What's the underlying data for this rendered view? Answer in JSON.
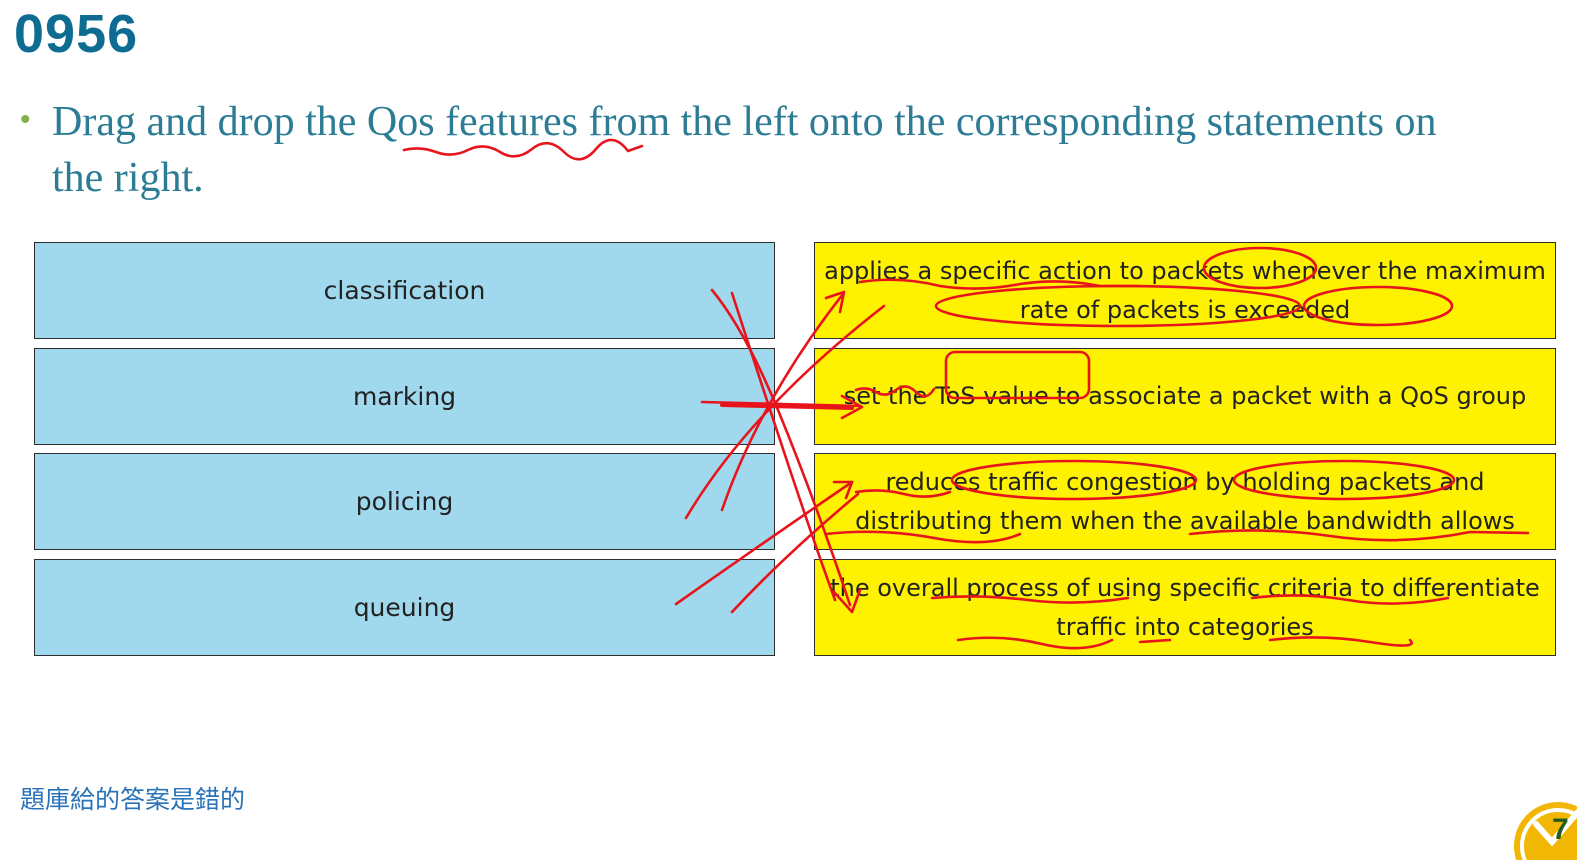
{
  "slide": {
    "number": "0956",
    "bullet": "•",
    "instruction": "Drag and drop the Qos features from the left onto the corresponding statements on the right."
  },
  "features": [
    {
      "label": "classification"
    },
    {
      "label": "marking"
    },
    {
      "label": "policing"
    },
    {
      "label": "queuing"
    }
  ],
  "statements": [
    {
      "text": "applies a specific action to packets whenever the maximum rate of packets is exceeded"
    },
    {
      "text": "set the ToS value to associate a packet with a QoS group"
    },
    {
      "text": "reduces traffic congestion by holding packets and distributing them when the available bandwidth allows"
    },
    {
      "text": "the overall process of using specific criteria to differentiate traffic into categories"
    }
  ],
  "footer": {
    "note": "題庫給的答案是錯的",
    "page_number": "7"
  },
  "colors": {
    "title": "#0e6c93",
    "instruction": "#2c7c96",
    "feature_box": "#a0d9ee",
    "statement_box": "#fff200",
    "annotation_ink": "#e8141c",
    "footer_note": "#2a73b8"
  }
}
